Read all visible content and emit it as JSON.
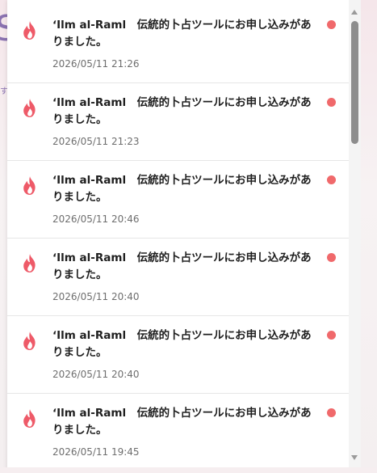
{
  "backdrop": {
    "glyph": "S",
    "small": "す"
  },
  "notifications": [
    {
      "icon": "flame-icon",
      "message": "ʻIlm al-Raml　伝統的卜占ツールにお申し込みがありました。",
      "time": "2026/05/11 21:26",
      "unread": true
    },
    {
      "icon": "flame-icon",
      "message": "ʻIlm al-Raml　伝統的卜占ツールにお申し込みがありました。",
      "time": "2026/05/11 21:23",
      "unread": true
    },
    {
      "icon": "flame-icon",
      "message": "ʻIlm al-Raml　伝統的卜占ツールにお申し込みがありました。",
      "time": "2026/05/11 20:46",
      "unread": true
    },
    {
      "icon": "flame-icon",
      "message": "ʻIlm al-Raml　伝統的卜占ツールにお申し込みがありました。",
      "time": "2026/05/11 20:40",
      "unread": true
    },
    {
      "icon": "flame-icon",
      "message": "ʻIlm al-Raml　伝統的卜占ツールにお申し込みがありました。",
      "time": "2026/05/11 20:40",
      "unread": true
    },
    {
      "icon": "flame-icon",
      "message": "ʻIlm al-Raml　伝統的卜占ツールにお申し込みがありました。",
      "time": "2026/05/11 19:45",
      "unread": true
    }
  ],
  "colors": {
    "flame": "#ee5a68",
    "unread_dot": "#f0696b"
  }
}
